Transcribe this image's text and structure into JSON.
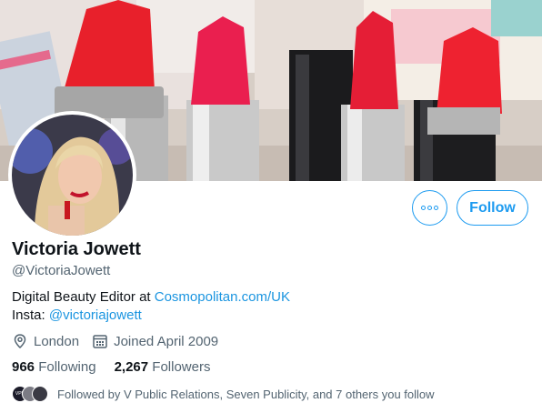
{
  "banner": {
    "description_icon": "lipstick-banner-image"
  },
  "avatar": {
    "icon": "profile-photo"
  },
  "actions": {
    "more_icon": "more-options-icon",
    "follow_label": "Follow"
  },
  "profile": {
    "name": "Victoria Jowett",
    "handle": "@VictoriaJowett",
    "bio_line1_prefix": "Digital Beauty Editor at ",
    "bio_line1_link": "Cosmopolitan.com/UK",
    "bio_line2_prefix": "Insta: ",
    "bio_line2_link": "@victoriajowett"
  },
  "meta": {
    "location": "London",
    "joined": "Joined April 2009"
  },
  "stats": {
    "following_count": "966",
    "following_label": "Following",
    "followers_count": "2,267",
    "followers_label": "Followers"
  },
  "followed_by": {
    "text": "Followed by V Public Relations, Seven Publicity, and 7 others you follow",
    "mini_avatar_label": "VPR"
  },
  "colors": {
    "accent": "#1d9bf0",
    "link": "#1b95e0",
    "text": "#0f1419",
    "muted": "#536471"
  }
}
